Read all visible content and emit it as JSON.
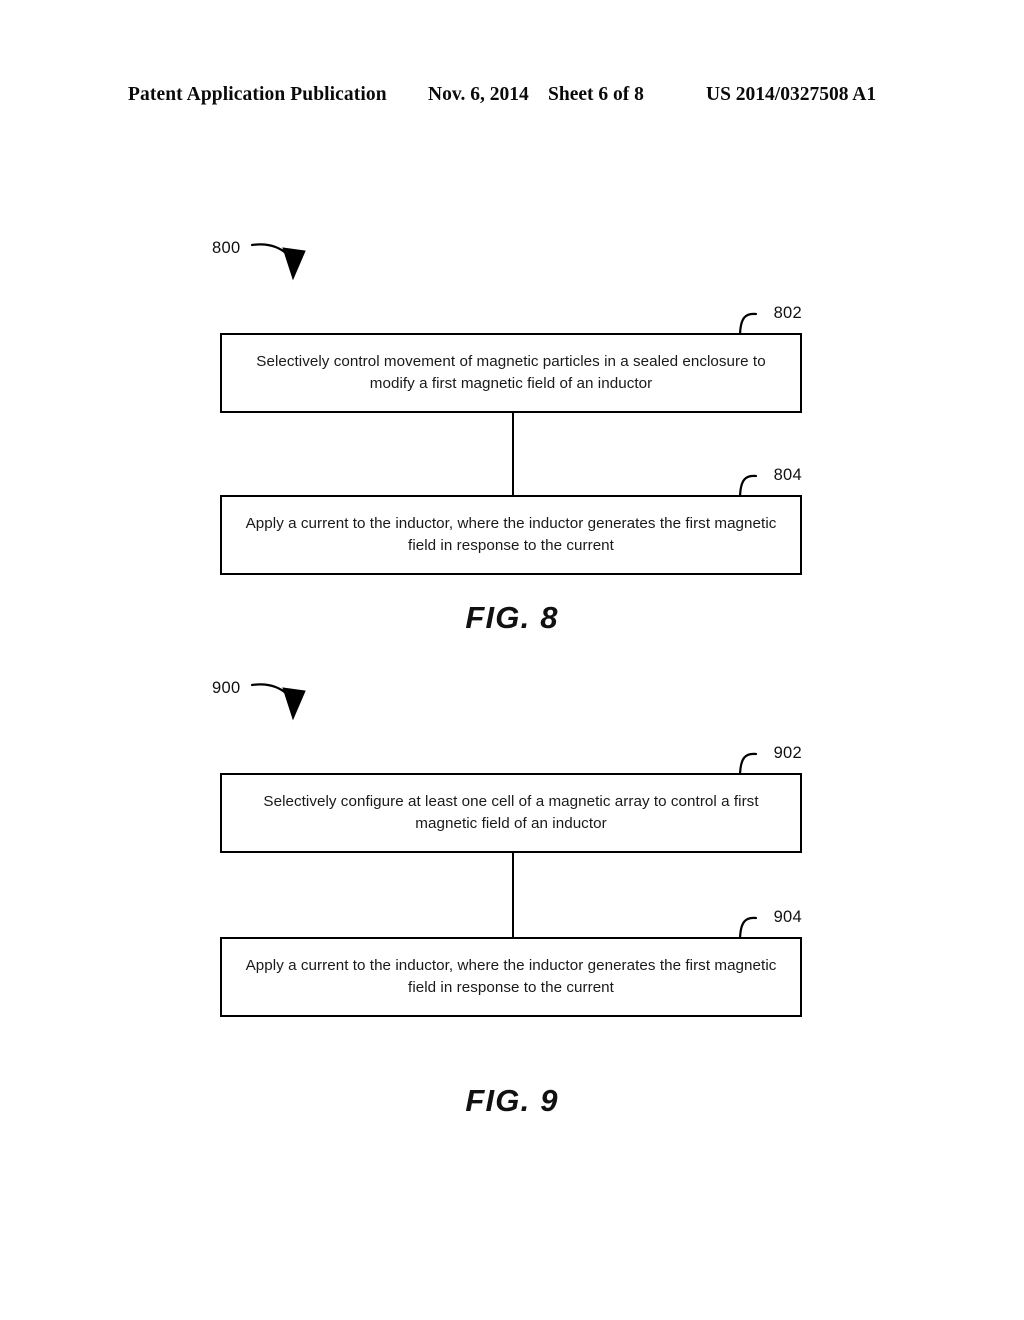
{
  "header": {
    "publication": "Patent Application Publication",
    "date": "Nov. 6, 2014",
    "sheet": "Sheet 6 of 8",
    "publication_number": "US 2014/0327508 A1"
  },
  "figures": [
    {
      "id": "figure-8",
      "flow_ref": "800",
      "caption": "FIG. 8",
      "steps": [
        {
          "ref": "802",
          "text": "Selectively control movement of magnetic particles in a sealed enclosure to modify a first magnetic field of an inductor"
        },
        {
          "ref": "804",
          "text": "Apply a current to the inductor, where the inductor generates the first magnetic field in response to the current"
        }
      ]
    },
    {
      "id": "figure-9",
      "flow_ref": "900",
      "caption": "FIG. 9",
      "steps": [
        {
          "ref": "902",
          "text": "Selectively configure at least one cell of a magnetic array to control a first magnetic field of an inductor"
        },
        {
          "ref": "904",
          "text": "Apply a current to the inductor, where the inductor generates the first magnetic field in response to the current"
        }
      ]
    }
  ],
  "colors": {
    "ink": "#000000",
    "text": "#1a1a1a",
    "page_background": "#ffffff"
  }
}
